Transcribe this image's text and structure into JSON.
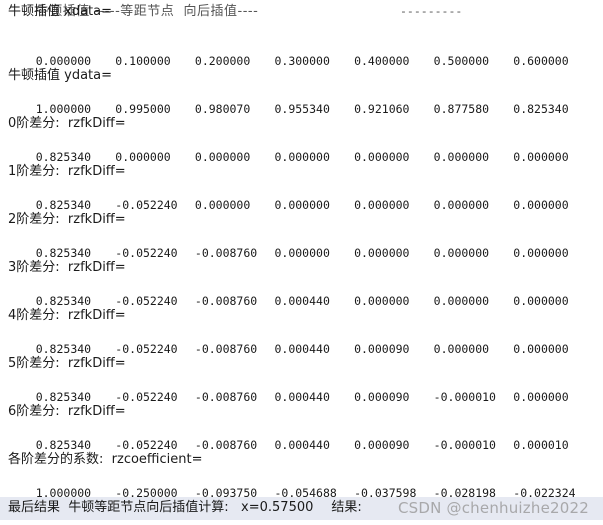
{
  "top_cut": {
    "left": "牛顿插值 -----等距节点  向后插值----",
    "right": "---------"
  },
  "sections": {
    "x_title": "牛顿插值 xdata=",
    "x_values": [
      "0.000000",
      "0.100000",
      "0.200000",
      "0.300000",
      "0.400000",
      "0.500000",
      "0.600000"
    ],
    "y_title": "牛顿插值 ydata=",
    "y_values": [
      "1.000000",
      "0.995000",
      "0.980070",
      "0.955340",
      "0.921060",
      "0.877580",
      "0.825340"
    ],
    "diffs": [
      {
        "title": "0阶差分:  rzfkDiff=",
        "values": [
          "0.825340",
          "0.000000",
          "0.000000",
          "0.000000",
          "0.000000",
          "0.000000",
          "0.000000"
        ]
      },
      {
        "title": "1阶差分:  rzfkDiff=",
        "values": [
          "0.825340",
          "-0.052240",
          "0.000000",
          "0.000000",
          "0.000000",
          "0.000000",
          "0.000000"
        ]
      },
      {
        "title": "2阶差分:  rzfkDiff=",
        "values": [
          "0.825340",
          "-0.052240",
          "-0.008760",
          "0.000000",
          "0.000000",
          "0.000000",
          "0.000000"
        ]
      },
      {
        "title": "3阶差分:  rzfkDiff=",
        "values": [
          "0.825340",
          "-0.052240",
          "-0.008760",
          "0.000440",
          "0.000000",
          "0.000000",
          "0.000000"
        ]
      },
      {
        "title": "4阶差分:  rzfkDiff=",
        "values": [
          "0.825340",
          "-0.052240",
          "-0.008760",
          "0.000440",
          "0.000090",
          "0.000000",
          "0.000000"
        ]
      },
      {
        "title": "5阶差分:  rzfkDiff=",
        "values": [
          "0.825340",
          "-0.052240",
          "-0.008760",
          "0.000440",
          "0.000090",
          "-0.000010",
          "0.000000"
        ]
      },
      {
        "title": "6阶差分:  rzfkDiff=",
        "values": [
          "0.825340",
          "-0.052240",
          "-0.008760",
          "0.000440",
          "0.000090",
          "-0.000010",
          "0.000010"
        ]
      }
    ],
    "coef_title": "各阶差分的系数:  rzcoefficient=",
    "coef_values": [
      "1.000000",
      "-0.250000",
      "-0.093750",
      "-0.054688",
      "-0.037598",
      "-0.028198",
      "-0.022324"
    ]
  },
  "final": {
    "label": "最后结果  牛顿等距节点向后插值计算:   x=0.57500",
    "result_prefix": "结果:"
  },
  "watermark": "CSDN @chenhuizhe2022"
}
